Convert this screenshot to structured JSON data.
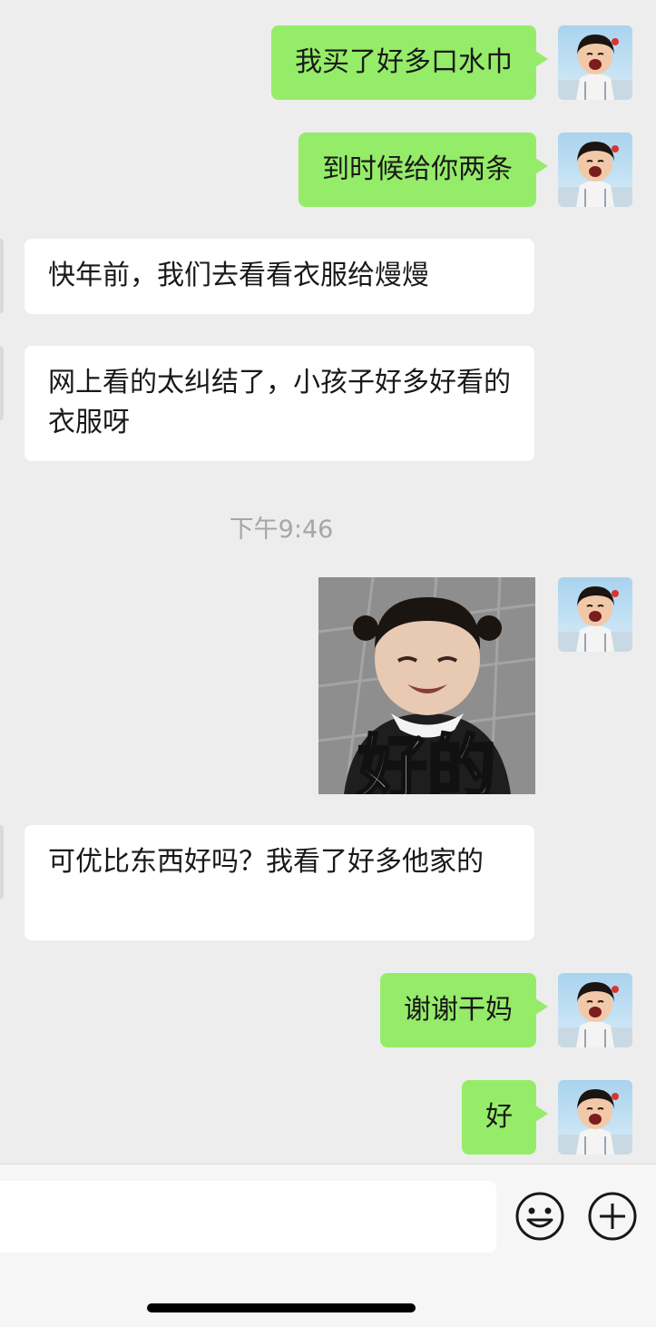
{
  "messages": [
    {
      "dir": "out",
      "text": "我买了好多口水巾"
    },
    {
      "dir": "out",
      "text": "到时候给你两条"
    },
    {
      "dir": "in",
      "text": "快年前，我们去看看衣服给熳熳"
    },
    {
      "dir": "in",
      "text": "网上看的太纠结了，小孩子好多好看的衣服呀"
    },
    {
      "dir": "out",
      "type": "sticker",
      "text": "好的"
    },
    {
      "dir": "in",
      "text": "可优比东西好吗？我看了好多他家的"
    },
    {
      "dir": "out",
      "text": "谢谢干妈"
    },
    {
      "dir": "out",
      "text": "好"
    }
  ],
  "timestamp": "下午9:46",
  "icons": {
    "self_avatar": "child-avatar",
    "emoji_button": "smiley-face-icon",
    "more_button": "plus-circle-icon"
  },
  "colors": {
    "outgoing_bubble": "#95ec69",
    "incoming_bubble": "#ffffff",
    "background": "#ededed"
  }
}
